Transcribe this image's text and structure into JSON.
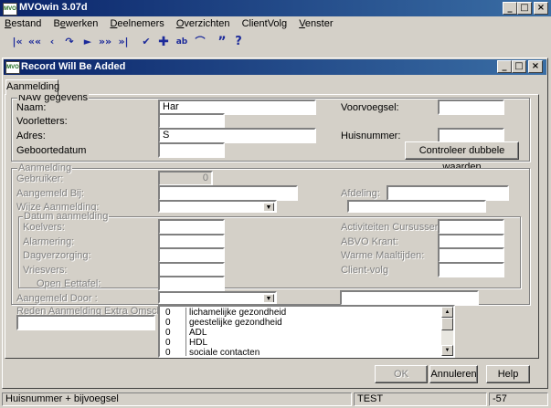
{
  "app": {
    "title": "MVOwin 3.07d",
    "icon_text": "MVO",
    "menu": [
      {
        "label": "Bestand",
        "key": "B"
      },
      {
        "label": "Bewerken",
        "key": "e"
      },
      {
        "label": "Deelnemers",
        "key": "D"
      },
      {
        "label": "Overzichten",
        "key": "O"
      },
      {
        "label": "ClientVolg",
        "key": ""
      },
      {
        "label": "Venster",
        "key": "V"
      }
    ]
  },
  "toolbar": {
    "icons": [
      "first-icon",
      "prev-page-icon",
      "prev-icon",
      "refresh-icon",
      "next-icon",
      "next-page-icon",
      "last-icon",
      "check-icon",
      "add-icon",
      "find-icon",
      "bookmark-icon",
      "quote-icon",
      "help-icon"
    ],
    "glyphs": [
      "⏮",
      "«",
      "‹",
      "↷",
      "►",
      "»",
      "⏭",
      "✔",
      "✚",
      "ab",
      "⌒",
      "”",
      "?"
    ]
  },
  "dialog": {
    "title": "Record Will Be Added",
    "icon_text": "MVO",
    "tab": "Aanmelding"
  },
  "naw": {
    "legend": "NAW gegevens",
    "naam_label": "Naam:",
    "naam_value": "Har",
    "voorletters_label": "Voorletters:",
    "voorletters_value": "",
    "adres_label": "Adres:",
    "adres_value": "S",
    "geboortedatum_label": "Geboortedatum",
    "geboortedatum_value": "",
    "voorvoegsel_label": "Voorvoegsel:",
    "voorvoegsel_value": "",
    "huisnummer_label": "Huisnummer:",
    "huisnummer_value": "",
    "controleer_button": "Controleer dubbele waarden"
  },
  "aanmelding": {
    "legend": "Aanmelding",
    "gebruiker_label": "Gebruiker:",
    "gebruiker_value": "0",
    "aangemeld_bij_label": "Aangemeld Bij:",
    "afdeling_label": "Afdeling:",
    "wijze_label": "Wijze Aanmelding:",
    "datum_legend": "Datum aanmelding",
    "left_fields": [
      "Koelvers:",
      "Alarmering:",
      "Dagverzorging:",
      "Vriesvers:",
      "Open Eettafel:"
    ],
    "right_fields": [
      "Activiteiten Cursussen:",
      "ABVO Krant:",
      "Warme Maaltijden:",
      "Client-volg"
    ],
    "aangemeld_door_label": "Aangemeld Door :",
    "reden_label": "Reden Aanmelding Extra Omschrijving:",
    "reden_items": [
      {
        "count": "0",
        "label": "lichamelijke gezondheid"
      },
      {
        "count": "0",
        "label": "geestelijke gezondheid"
      },
      {
        "count": "0",
        "label": "ADL"
      },
      {
        "count": "0",
        "label": "HDL"
      },
      {
        "count": "0",
        "label": "sociale contacten"
      }
    ]
  },
  "buttons": {
    "ok": "OK",
    "annuleren": "Annuleren",
    "help": "Help"
  },
  "statusbar": {
    "left": "Huisnummer + bijvoegsel",
    "center": "TEST",
    "right": "-57"
  }
}
